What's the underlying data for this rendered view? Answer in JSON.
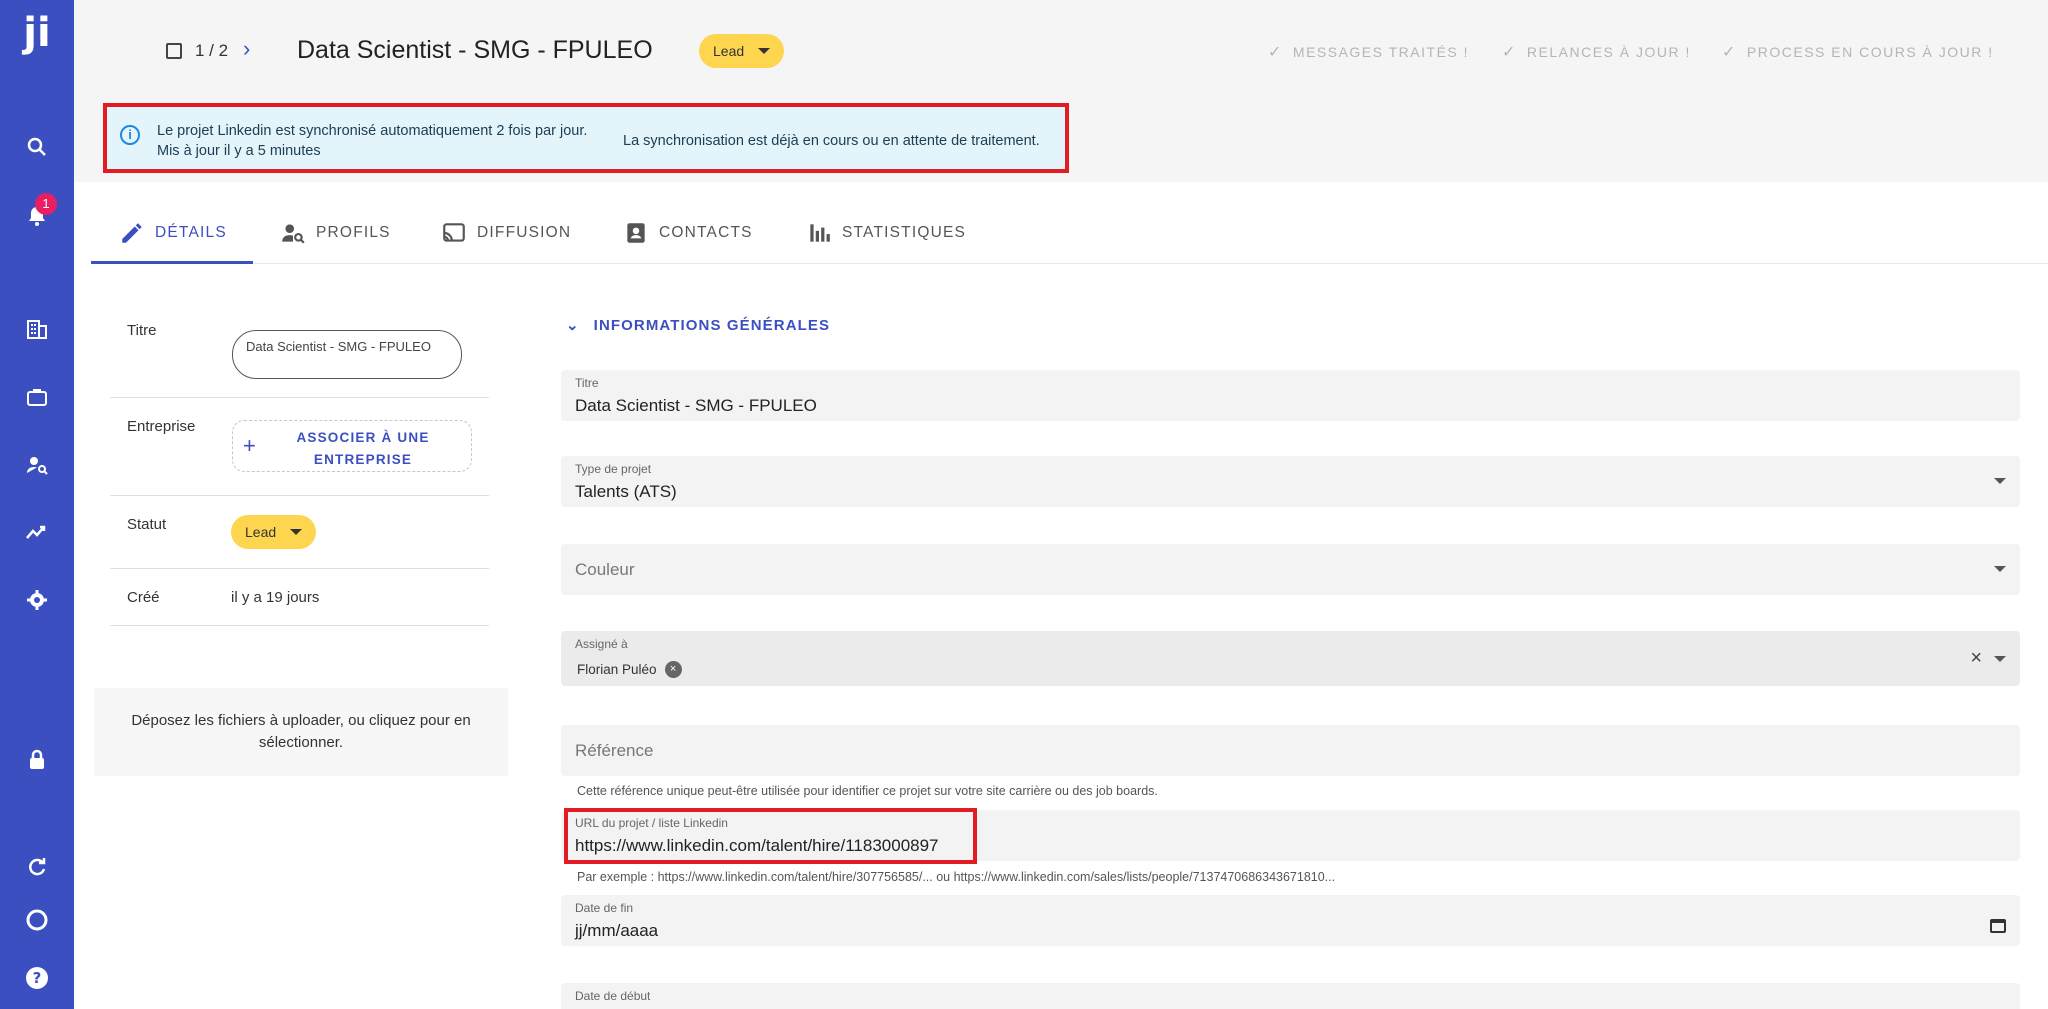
{
  "sidebar": {
    "logo": "ji",
    "notification_count": "1",
    "icons": [
      "search-icon",
      "bell-icon",
      "building-icon",
      "briefcase-icon",
      "person-search-icon",
      "trending-icon",
      "gear-icon",
      "lock-icon",
      "refresh-icon",
      "loader-icon",
      "help-icon"
    ]
  },
  "header": {
    "pager": "1 / 2",
    "title": "Data Scientist - SMG - FPULEO",
    "status": "Lead",
    "actions": [
      "MESSAGES TRAITÉS !",
      "RELANCES À JOUR !",
      "PROCESS EN COURS À JOUR !"
    ]
  },
  "banner": {
    "line1": "Le projet Linkedin est synchronisé automatiquement 2 fois par jour.",
    "line2": "Mis à jour il y a 5 minutes",
    "right": "La synchronisation est déjà en cours ou en attente de traitement."
  },
  "tabs": [
    "DÉTAILS",
    "PROFILS",
    "DIFFUSION",
    "CONTACTS",
    "STATISTIQUES"
  ],
  "left_panel": {
    "titre_label": "Titre",
    "titre_value": "Data Scientist - SMG - FPULEO",
    "entreprise_label": "Entreprise",
    "associer_label": "ASSOCIER À UNE ENTREPRISE",
    "statut_label": "Statut",
    "statut_value": "Lead",
    "cree_label": "Créé",
    "cree_value": "il y a 19 jours",
    "dropzone_text": "Déposez les fichiers à uploader, ou cliquez pour en sélectionner."
  },
  "form": {
    "section_title": "INFORMATIONS GÉNÉRALES",
    "titre": {
      "label": "Titre",
      "value": "Data Scientist - SMG - FPULEO"
    },
    "type": {
      "label": "Type de projet",
      "value": "Talents (ATS)"
    },
    "couleur": {
      "placeholder": "Couleur"
    },
    "assigne": {
      "label": "Assigné à",
      "chip": "Florian Puléo"
    },
    "reference": {
      "placeholder": "Référence",
      "helper": "Cette référence unique peut-être utilisée pour identifier ce projet sur votre site carrière ou des job boards."
    },
    "url": {
      "label": "URL du projet / liste Linkedin",
      "value": "https://www.linkedin.com/talent/hire/1183000897",
      "helper": "Par exemple : https://www.linkedin.com/talent/hire/307756585/... ou https://www.linkedin.com/sales/lists/people/7137470686343671810..."
    },
    "date_fin": {
      "label": "Date de fin",
      "value": "jj/mm/aaaa"
    },
    "date_debut": {
      "label": "Date de début"
    }
  },
  "colors": {
    "sidebar": "#3c4fc0",
    "accent": "#3c4fc0",
    "status_lead": "#fdd54f",
    "highlight_border": "#e31b23",
    "banner_bg": "#e3f4fb"
  }
}
